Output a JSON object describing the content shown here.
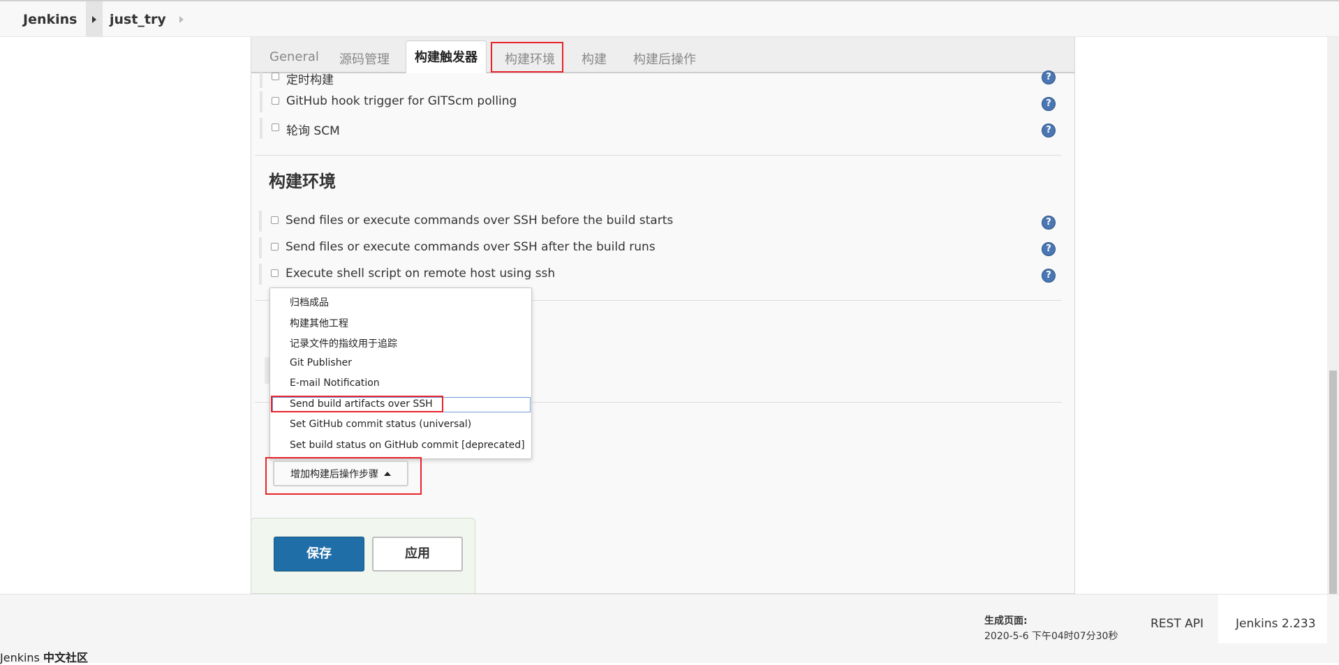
{
  "breadcrumb": {
    "home": "Jenkins",
    "project": "just_try"
  },
  "tabs": {
    "general": "General",
    "scm": "源码管理",
    "triggers": "构建触发器",
    "env": "构建环境",
    "build": "构建",
    "post": "构建后操作"
  },
  "triggers": {
    "items": [
      {
        "label": "定时构建",
        "checked": false
      },
      {
        "label": "GitHub hook trigger for GITScm polling",
        "checked": false
      },
      {
        "label": "轮询 SCM",
        "checked": false
      }
    ]
  },
  "build_env": {
    "title": "构建环境",
    "items": [
      {
        "label": "Send files or execute commands over SSH before the build starts",
        "checked": false
      },
      {
        "label": "Send files or execute commands over SSH after the build runs",
        "checked": false
      },
      {
        "label": "Execute shell script on remote host using ssh",
        "checked": false
      }
    ]
  },
  "help_glyph": "?",
  "post_build_menu": {
    "items": [
      "归档成品",
      "构建其他工程",
      "记录文件的指纹用于追踪",
      "Git Publisher",
      "E-mail Notification",
      "Send build artifacts over SSH",
      "Set GitHub commit status (universal)",
      "Set build status on GitHub commit [deprecated]"
    ],
    "highlighted": "Send build artifacts over SSH"
  },
  "add_post_build_button": "增加构建后操作步骤",
  "buttons": {
    "save": "保存",
    "apply": "应用"
  },
  "footer": {
    "generated_label": "生成页面:",
    "generated_time": "2020-5-6 下午04时07分30秒",
    "rest_api": "REST API",
    "version": "Jenkins 2.233",
    "community_prefix": "Jenkins ",
    "community_bold": "中文社区"
  },
  "colors": {
    "annotation_red": "#e8232a",
    "save_blue": "#1f6ea8",
    "help_blue": "#4a77b4",
    "menu_highlight": "#6e9ad6"
  }
}
